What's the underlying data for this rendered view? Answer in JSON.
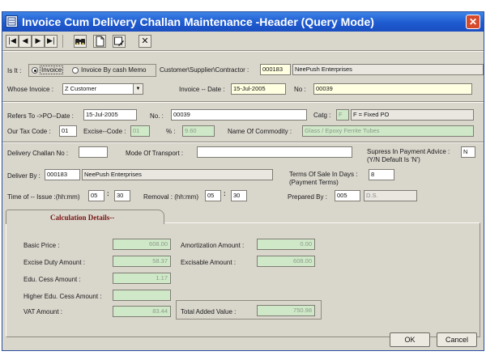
{
  "window": {
    "title": "Invoice Cum Delivery Challan Maintenance -Header (Query Mode)",
    "close_glyph": "✕",
    "app_icon": "form-icon"
  },
  "toolbar": [
    {
      "name": "first-record",
      "icon": "first-icon",
      "glyph": "|◀"
    },
    {
      "name": "prev-record",
      "icon": "prev-icon",
      "glyph": "◀"
    },
    {
      "name": "next-record",
      "icon": "next-icon",
      "glyph": "▶"
    },
    {
      "name": "last-record",
      "icon": "last-icon",
      "glyph": "▶|"
    },
    {
      "name": "find",
      "icon": "binoculars-icon",
      "glyph": "👀"
    },
    {
      "name": "new",
      "icon": "new-document-icon",
      "glyph": "🗋"
    },
    {
      "name": "edit",
      "icon": "edit-icon",
      "glyph": "✎"
    },
    {
      "name": "delete",
      "icon": "delete-icon",
      "glyph": "✕"
    }
  ],
  "header": {
    "is_it_label": "Is It :",
    "radio_invoice": "Invoice",
    "radio_cash_memo": "Invoice By cash Memo",
    "selected_radio": "Invoice",
    "customer_label": "Customer\\Supplier\\Contractor :",
    "customer_code": "000183",
    "customer_name": "NeePush Enterprises",
    "whose_invoice_label": "Whose Invoice :",
    "whose_invoice_value": "Z Customer",
    "invoice_date_label": "Invoice -- Date :",
    "invoice_date": "15-Jul-2005",
    "no_label": "No :",
    "invoice_no": "00039"
  },
  "refs": {
    "refers_to_label": "Refers To ->PO--Date :",
    "po_date": "15-Jul-2005",
    "no_label": "No. :",
    "po_no": "00039",
    "catg_label": "Catg :",
    "catg_code": "F",
    "catg_desc": "F = Fixed PO",
    "tax_code_label": "Our Tax Code :",
    "tax_code": "01",
    "excise_code_label": "Excise--Code :",
    "excise_code": "01",
    "percent_label": "% :",
    "percent_value": "9.60",
    "commodity_label": "Name Of  Commodity :",
    "commodity_value": "Glass / Epoxy Ferrite Tubes"
  },
  "delivery": {
    "challan_no_label": "Delivery Challan No :",
    "challan_no": "",
    "transport_label": "Mode Of Transport :",
    "transport_value": "",
    "supress_label_1": "Supress In Payment Advice :",
    "supress_label_2": "(Y/N  Default Is 'N')",
    "supress_value": "N",
    "deliver_by_label": "Deliver By :",
    "deliver_by_code": "000183",
    "deliver_by_name": "NeePush Enterprises",
    "terms_label_1": "Terms Of Sale In Days :",
    "terms_label_2": "(Payment Terms)",
    "terms_value": "8",
    "time_issue_label": "Time of -- Issue :(hh:mm)",
    "issue_hh": "05",
    "issue_mm": "30",
    "removal_label": "Removal : (hh:mm)",
    "removal_hh": "05",
    "removal_mm": "30",
    "colon": ":",
    "prepared_by_label": "Prepared By :",
    "prepared_by_code": "005",
    "prepared_by_name": "D.S."
  },
  "calculation": {
    "tab_label": "Calculation Details--",
    "basic_price_label": "Basic Price :",
    "basic_price": "608.00",
    "excise_duty_label": "Excise Duty Amount :",
    "excise_duty": "58.37",
    "edu_cess_label": "Edu. Cess Amount :",
    "edu_cess": "1.17",
    "higher_edu_cess_label": "Higher Edu. Cess Amount :",
    "higher_edu_cess": "",
    "vat_label": "VAT Amount :",
    "vat": "83.44",
    "amortization_label": "Amortization Amount :",
    "amortization": "0.00",
    "excisable_label": "Excisable Amount :",
    "excisable": "608.00",
    "total_added_label": "Total Added Value :",
    "total_added": "750.98"
  },
  "buttons": {
    "ok": "OK",
    "cancel": "Cancel"
  }
}
